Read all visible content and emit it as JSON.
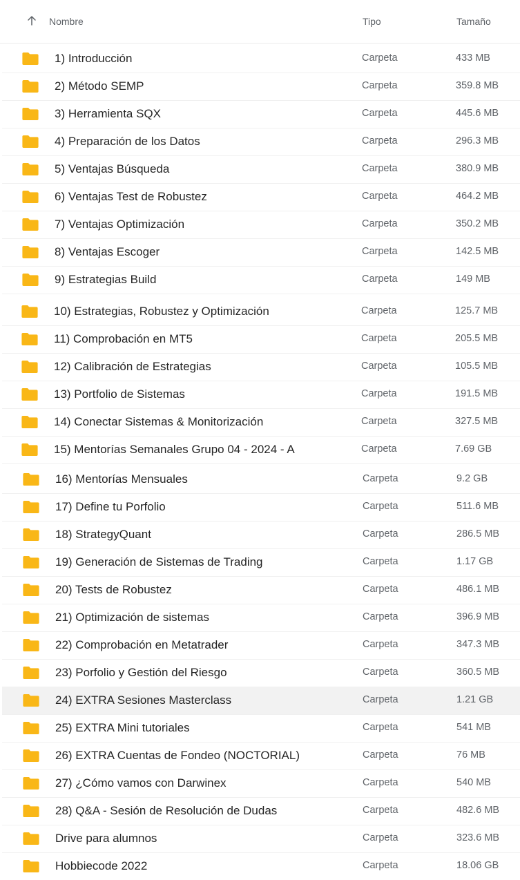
{
  "header": {
    "sort_icon": "arrow-up-icon",
    "name_label": "Nombre",
    "type_label": "Tipo",
    "size_label": "Tamaño"
  },
  "folder_icon": "folder-icon",
  "folder_color": "#F9B717",
  "highlight_color": "#F2F2F2",
  "files": [
    {
      "name": "1) Introducción",
      "type": "Carpeta",
      "size": "433 MB"
    },
    {
      "name": "2) Método SEMP",
      "type": "Carpeta",
      "size": "359.8 MB"
    },
    {
      "name": "3) Herramienta SQX",
      "type": "Carpeta",
      "size": "445.6 MB"
    },
    {
      "name": "4) Preparación de los Datos",
      "type": "Carpeta",
      "size": "296.3 MB"
    },
    {
      "name": "5) Ventajas Búsqueda",
      "type": "Carpeta",
      "size": "380.9 MB"
    },
    {
      "name": "6) Ventajas Test de Robustez",
      "type": "Carpeta",
      "size": "464.2 MB"
    },
    {
      "name": "7) Ventajas Optimización",
      "type": "Carpeta",
      "size": "350.2 MB"
    },
    {
      "name": "8) Ventajas Escoger",
      "type": "Carpeta",
      "size": "142.5 MB"
    },
    {
      "name": "9) Estrategias Build",
      "type": "Carpeta",
      "size": "149 MB"
    },
    {
      "name": "10) Estrategias, Robustez y Optimización",
      "type": "Carpeta",
      "size": "125.7 MB"
    },
    {
      "name": "11) Comprobación en MT5",
      "type": "Carpeta",
      "size": "205.5 MB"
    },
    {
      "name": "12) Calibración de Estrategias",
      "type": "Carpeta",
      "size": "105.5 MB"
    },
    {
      "name": "13) Portfolio de Sistemas",
      "type": "Carpeta",
      "size": "191.5 MB"
    },
    {
      "name": "14) Conectar Sistemas & Monitorización",
      "type": "Carpeta",
      "size": "327.5 MB"
    },
    {
      "name": "15) Mentorías Semanales Grupo 04 - 2024 - A",
      "type": "Carpeta",
      "size": "7.69 GB"
    },
    {
      "name": "16) Mentorías Mensuales",
      "type": "Carpeta",
      "size": "9.2 GB"
    },
    {
      "name": "17) Define tu Porfolio",
      "type": "Carpeta",
      "size": "511.6 MB"
    },
    {
      "name": "18) StrategyQuant",
      "type": "Carpeta",
      "size": "286.5 MB"
    },
    {
      "name": "19) Generación de Sistemas de Trading",
      "type": "Carpeta",
      "size": "1.17 GB"
    },
    {
      "name": "20) Tests de Robustez",
      "type": "Carpeta",
      "size": "486.1 MB"
    },
    {
      "name": "21) Optimización de sistemas",
      "type": "Carpeta",
      "size": "396.9 MB"
    },
    {
      "name": "22) Comprobación en Metatrader",
      "type": "Carpeta",
      "size": "347.3 MB"
    },
    {
      "name": "23) Porfolio y Gestión del Riesgo",
      "type": "Carpeta",
      "size": "360.5 MB"
    },
    {
      "name": "24) EXTRA Sesiones Masterclass",
      "type": "Carpeta",
      "size": "1.21 GB",
      "highlighted": true
    },
    {
      "name": "25) EXTRA Mini tutoriales",
      "type": "Carpeta",
      "size": "541 MB"
    },
    {
      "name": "26) EXTRA Cuentas de Fondeo (NOCTORIAL)",
      "type": "Carpeta",
      "size": "76 MB"
    },
    {
      "name": "27) ¿Cómo vamos con Darwinex",
      "type": "Carpeta",
      "size": "540 MB"
    },
    {
      "name": "28) Q&A - Sesión de Resolución de Dudas",
      "type": "Carpeta",
      "size": "482.6 MB"
    },
    {
      "name": "Drive para alumnos",
      "type": "Carpeta",
      "size": "323.6 MB"
    },
    {
      "name": "Hobbiecode 2022",
      "type": "Carpeta",
      "size": "18.06 GB"
    }
  ]
}
